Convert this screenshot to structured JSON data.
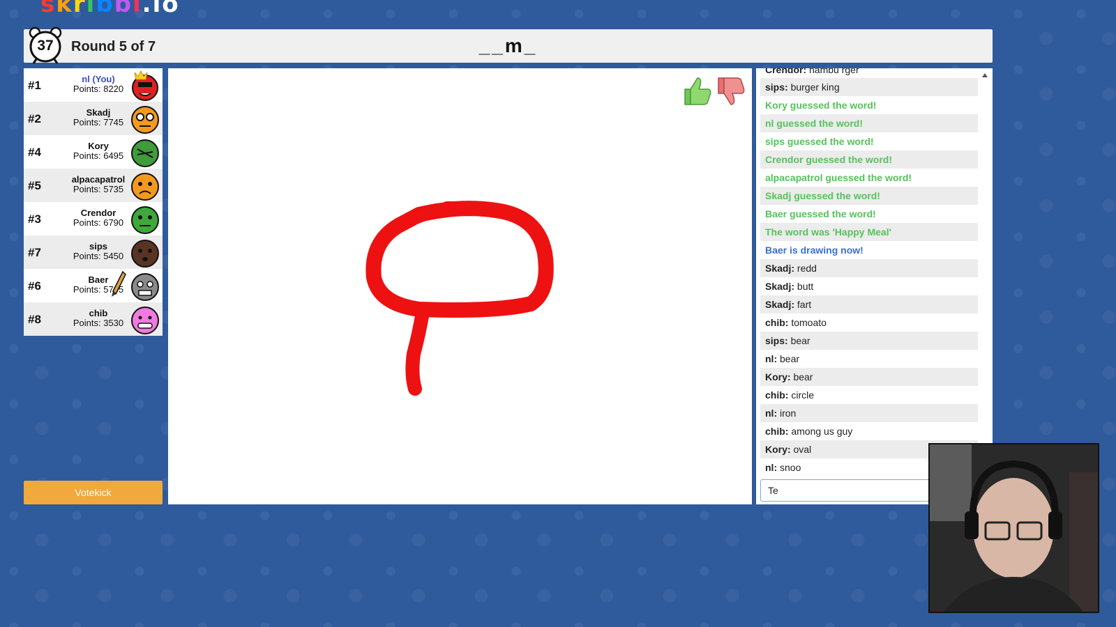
{
  "logo": {
    "letters": [
      "s",
      "k",
      "r",
      "i",
      "b",
      "b",
      "l",
      ".io"
    ]
  },
  "header": {
    "timer": "37",
    "round": "Round 5 of 7",
    "word_hint": "__m_"
  },
  "players": [
    {
      "rank": "#1",
      "name": "nl (You)",
      "points": "Points: 8220",
      "you": true,
      "crown": true,
      "face_color": "#e02020"
    },
    {
      "rank": "#2",
      "name": "Skadj",
      "points": "Points: 7745",
      "face_color": "#f39a1e"
    },
    {
      "rank": "#4",
      "name": "Kory",
      "points": "Points: 6495",
      "face_color": "#3e9c3a"
    },
    {
      "rank": "#5",
      "name": "alpacapatrol",
      "points": "Points: 5735",
      "face_color": "#f39a1e"
    },
    {
      "rank": "#3",
      "name": "Crendor",
      "points": "Points: 6790",
      "face_color": "#3ea83a"
    },
    {
      "rank": "#7",
      "name": "sips",
      "points": "Points: 5450",
      "face_color": "#5a3422"
    },
    {
      "rank": "#6",
      "name": "Baer",
      "points": "Points: 5705",
      "drawing": true,
      "face_color": "#8a8a8a"
    },
    {
      "rank": "#8",
      "name": "chib",
      "points": "Points: 3530",
      "face_color": "#f07adf"
    }
  ],
  "votekick_label": "Votekick",
  "chat": {
    "messages": [
      {
        "user": "Crendor:",
        "text": " hambu rger",
        "clipped": true
      },
      {
        "user": "sips:",
        "text": " burger king"
      },
      {
        "system": "Kory guessed the word!",
        "color": "green"
      },
      {
        "system": "nl guessed the word!",
        "color": "green"
      },
      {
        "system": "sips guessed the word!",
        "color": "green"
      },
      {
        "system": "Crendor guessed the word!",
        "color": "green"
      },
      {
        "system": "alpacapatrol guessed the word!",
        "color": "green"
      },
      {
        "system": "Skadj guessed the word!",
        "color": "green"
      },
      {
        "system": "Baer guessed the word!",
        "color": "green"
      },
      {
        "system": "The word was 'Happy Meal'",
        "color": "green"
      },
      {
        "system": "Baer is drawing now!",
        "color": "blue"
      },
      {
        "user": "Skadj:",
        "text": " redd"
      },
      {
        "user": "Skadj:",
        "text": " butt"
      },
      {
        "user": "Skadj:",
        "text": " fart"
      },
      {
        "user": "chib:",
        "text": " tomoato"
      },
      {
        "user": "sips:",
        "text": " bear"
      },
      {
        "user": "nl:",
        "text": " bear"
      },
      {
        "user": "Kory:",
        "text": " bear"
      },
      {
        "user": "chib:",
        "text": " circle"
      },
      {
        "user": "nl:",
        "text": " iron"
      },
      {
        "user": "chib:",
        "text": " among us guy"
      },
      {
        "user": "Kory:",
        "text": " oval"
      },
      {
        "user": "nl:",
        "text": " snoo"
      }
    ],
    "input_value": "Te"
  },
  "colors": {
    "drawing_stroke": "#ee1111",
    "accent_green": "#56c25a",
    "accent_blue": "#3a6fd1",
    "votekick": "#f0a93a"
  }
}
